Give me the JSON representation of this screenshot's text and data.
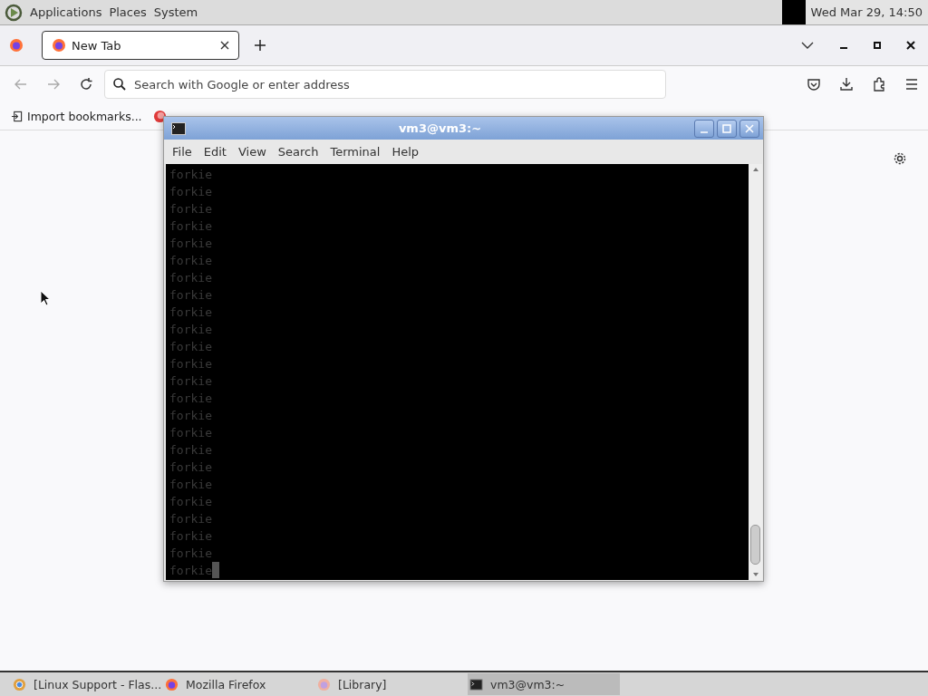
{
  "top_panel": {
    "menus": [
      "Applications",
      "Places",
      "System"
    ],
    "clock": "Wed Mar 29, 14:50"
  },
  "browser": {
    "tabs": [
      {
        "label": "New Tab",
        "selected": true
      }
    ],
    "address_bar": {
      "placeholder": "Search with Google or enter address"
    },
    "bookmarks": [
      {
        "kind": "import",
        "label": "Import bookmarks..."
      },
      {
        "kind": "page"
      }
    ]
  },
  "terminal": {
    "title": "vm3@vm3:~",
    "menus": [
      "File",
      "Edit",
      "View",
      "Search",
      "Terminal",
      "Help"
    ],
    "lines": [
      "forkie",
      "forkie",
      "forkie",
      "forkie",
      "forkie",
      "forkie",
      "forkie",
      "forkie",
      "forkie",
      "forkie",
      "forkie",
      "forkie",
      "forkie",
      "forkie",
      "forkie",
      "forkie",
      "forkie",
      "forkie",
      "forkie",
      "forkie",
      "forkie",
      "forkie",
      "forkie",
      "forkie"
    ]
  },
  "taskbar": [
    {
      "label": "[Linux Support - Flas...",
      "kind": "chrome",
      "selected": false
    },
    {
      "label": "Mozilla Firefox",
      "kind": "firefox",
      "selected": false
    },
    {
      "label": "[Library]",
      "kind": "library",
      "selected": false
    },
    {
      "label": "vm3@vm3:~",
      "kind": "terminal",
      "selected": true
    }
  ]
}
